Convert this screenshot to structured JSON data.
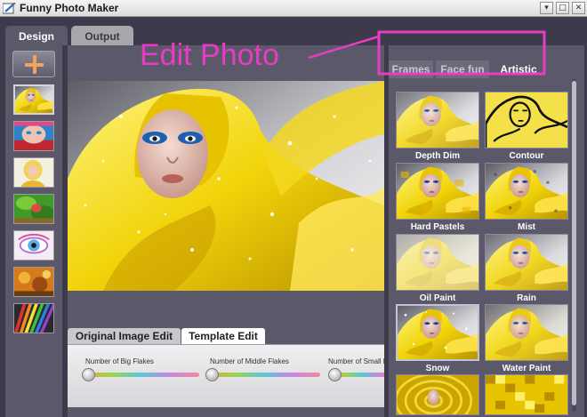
{
  "window": {
    "title": "Funny Photo Maker",
    "controls": [
      "▾",
      "□",
      "✕"
    ],
    "icon": "app-brush-icon"
  },
  "top_tabs": [
    {
      "label": "Design",
      "active": true
    },
    {
      "label": "Output",
      "active": false
    }
  ],
  "left_panel": {
    "add_button_icon": "plus-icon",
    "accent_color": "#f3a35a",
    "thumbnails": [
      {
        "subject": "yellow-splash-portrait",
        "selected": true
      },
      {
        "subject": "blue-eyes-closeup",
        "selected": false
      },
      {
        "subject": "blonde-woman-yellow",
        "selected": false
      },
      {
        "subject": "green-landscape",
        "selected": false
      },
      {
        "subject": "colorful-eye",
        "selected": false
      },
      {
        "subject": "orange-texture",
        "selected": false
      },
      {
        "subject": "rainbow-pencils",
        "selected": false
      }
    ]
  },
  "annotation": {
    "text": "Edit Photo",
    "color": "#e83cc5"
  },
  "effect_tabs": [
    {
      "label": "Frames",
      "active": false
    },
    {
      "label": "Face fun",
      "active": false
    },
    {
      "label": "Artistic",
      "active": true
    }
  ],
  "effects": [
    {
      "name": "Depth Dim",
      "selected": false
    },
    {
      "name": "Contour",
      "selected": false
    },
    {
      "name": "Hard Pastels",
      "selected": false
    },
    {
      "name": "Mist",
      "selected": false
    },
    {
      "name": "Oil Paint",
      "selected": false
    },
    {
      "name": "Rain",
      "selected": false
    },
    {
      "name": "Snow",
      "selected": true
    },
    {
      "name": "Water Paint",
      "selected": false
    },
    {
      "name": "",
      "selected": false
    },
    {
      "name": "",
      "selected": false
    }
  ],
  "edit_tabs": [
    {
      "label": "Original Image Edit",
      "active": false
    },
    {
      "label": "Template Edit",
      "active": true
    }
  ],
  "sliders": [
    {
      "label": "Number of Big Flakes",
      "value": 0.05
    },
    {
      "label": "Number of Middle Flakes",
      "value": 0.05
    },
    {
      "label": "Number of Small F",
      "value": 0.05
    }
  ]
}
